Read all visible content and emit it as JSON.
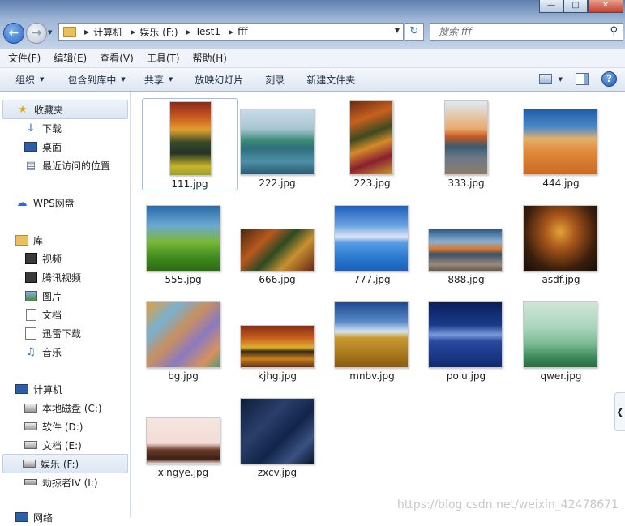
{
  "window": {
    "min_glyph": "—",
    "max_glyph": "□",
    "close_glyph": "✕"
  },
  "address": {
    "breadcrumbs": [
      "计算机",
      "娱乐 (F:)",
      "Test1",
      "fff"
    ]
  },
  "search": {
    "placeholder": "搜索 fff"
  },
  "menu": [
    "文件(F)",
    "编辑(E)",
    "查看(V)",
    "工具(T)",
    "帮助(H)"
  ],
  "commands": {
    "organize": "组织",
    "include_in_library": "包含到库中",
    "share": "共享",
    "slideshow": "放映幻灯片",
    "burn": "刻录",
    "new_folder": "新建文件夹"
  },
  "nav": {
    "favorites": "收藏夹",
    "downloads": "下载",
    "desktop": "桌面",
    "recent": "最近访问的位置",
    "wps": "WPS网盘",
    "libraries": "库",
    "videos": "视频",
    "tencent_video": "腾讯视频",
    "pictures": "图片",
    "documents": "文档",
    "xunlei": "迅雷下载",
    "music": "音乐",
    "computer": "计算机",
    "drive_c": "本地磁盘 (C:)",
    "drive_d": "软件 (D:)",
    "drive_e": "文档 (E:)",
    "drive_f": "娱乐 (F:)",
    "drive_i": "劫掠者IV (I:)",
    "network": "网络"
  },
  "files": [
    {
      "name": "111.jpg"
    },
    {
      "name": "222.jpg"
    },
    {
      "name": "223.jpg"
    },
    {
      "name": "333.jpg"
    },
    {
      "name": "444.jpg"
    },
    {
      "name": "555.jpg"
    },
    {
      "name": "666.jpg"
    },
    {
      "name": "777.jpg"
    },
    {
      "name": "888.jpg"
    },
    {
      "name": "asdf.jpg"
    },
    {
      "name": "bg.jpg"
    },
    {
      "name": "kjhg.jpg"
    },
    {
      "name": "mnbv.jpg"
    },
    {
      "name": "poiu.jpg"
    },
    {
      "name": "qwer.jpg"
    },
    {
      "name": "xingye.jpg"
    },
    {
      "name": "zxcv.jpg"
    }
  ],
  "watermark": "https://blog.csdn.net/weixin_42478671"
}
